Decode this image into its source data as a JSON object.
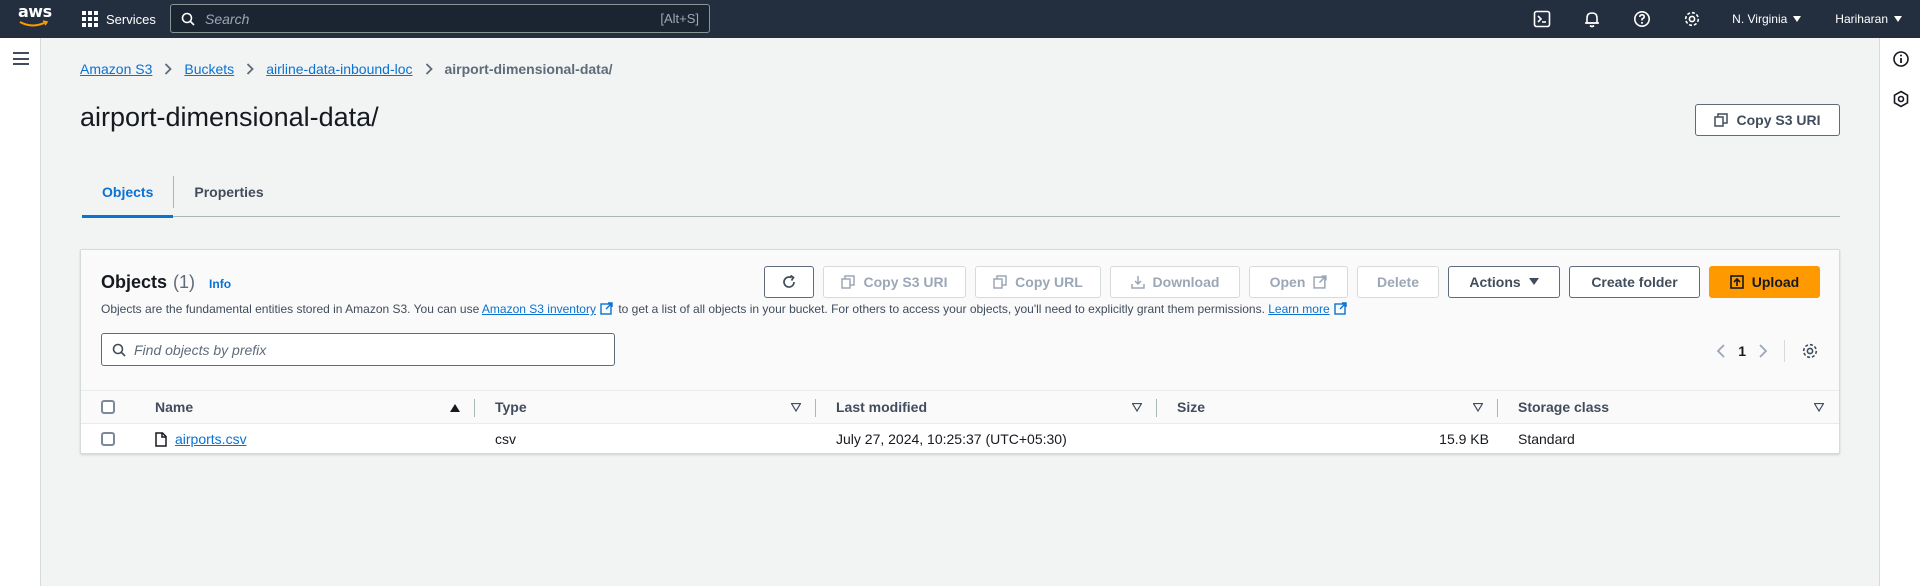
{
  "topnav": {
    "logo": "aws",
    "services_label": "Services",
    "search_placeholder": "Search",
    "search_shortcut": "[Alt+S]",
    "region": "N. Virginia",
    "user": "Hariharan"
  },
  "breadcrumb": {
    "items": [
      "Amazon S3",
      "Buckets",
      "airline-data-inbound-loc"
    ],
    "current": "airport-dimensional-data/"
  },
  "page": {
    "title": "airport-dimensional-data/",
    "copy_uri_label": "Copy S3 URI"
  },
  "tabs": [
    {
      "label": "Objects",
      "active": true
    },
    {
      "label": "Properties",
      "active": false
    }
  ],
  "objects_panel": {
    "title": "Objects",
    "count": "(1)",
    "info": "Info",
    "desc_part1": "Objects are the fundamental entities stored in Amazon S3. You can use ",
    "desc_link1": "Amazon S3 inventory",
    "desc_part2": " to get a list of all objects in your bucket. For others to access your objects, you'll need to explicitly grant them permissions. ",
    "desc_link2": "Learn more",
    "buttons": {
      "copy_uri": "Copy S3 URI",
      "copy_url": "Copy URL",
      "download": "Download",
      "open": "Open",
      "delete": "Delete",
      "actions": "Actions",
      "create_folder": "Create folder",
      "upload": "Upload"
    },
    "filter_placeholder": "Find objects by prefix",
    "page_number": "1",
    "columns": [
      "Name",
      "Type",
      "Last modified",
      "Size",
      "Storage class"
    ],
    "rows": [
      {
        "name": "airports.csv",
        "type": "csv",
        "last_modified": "July 27, 2024, 10:25:37 (UTC+05:30)",
        "size": "15.9 KB",
        "storage_class": "Standard"
      }
    ]
  },
  "colors": {
    "nav_bg": "#232f3e",
    "link": "#0972d3",
    "primary": "#ff9900"
  }
}
